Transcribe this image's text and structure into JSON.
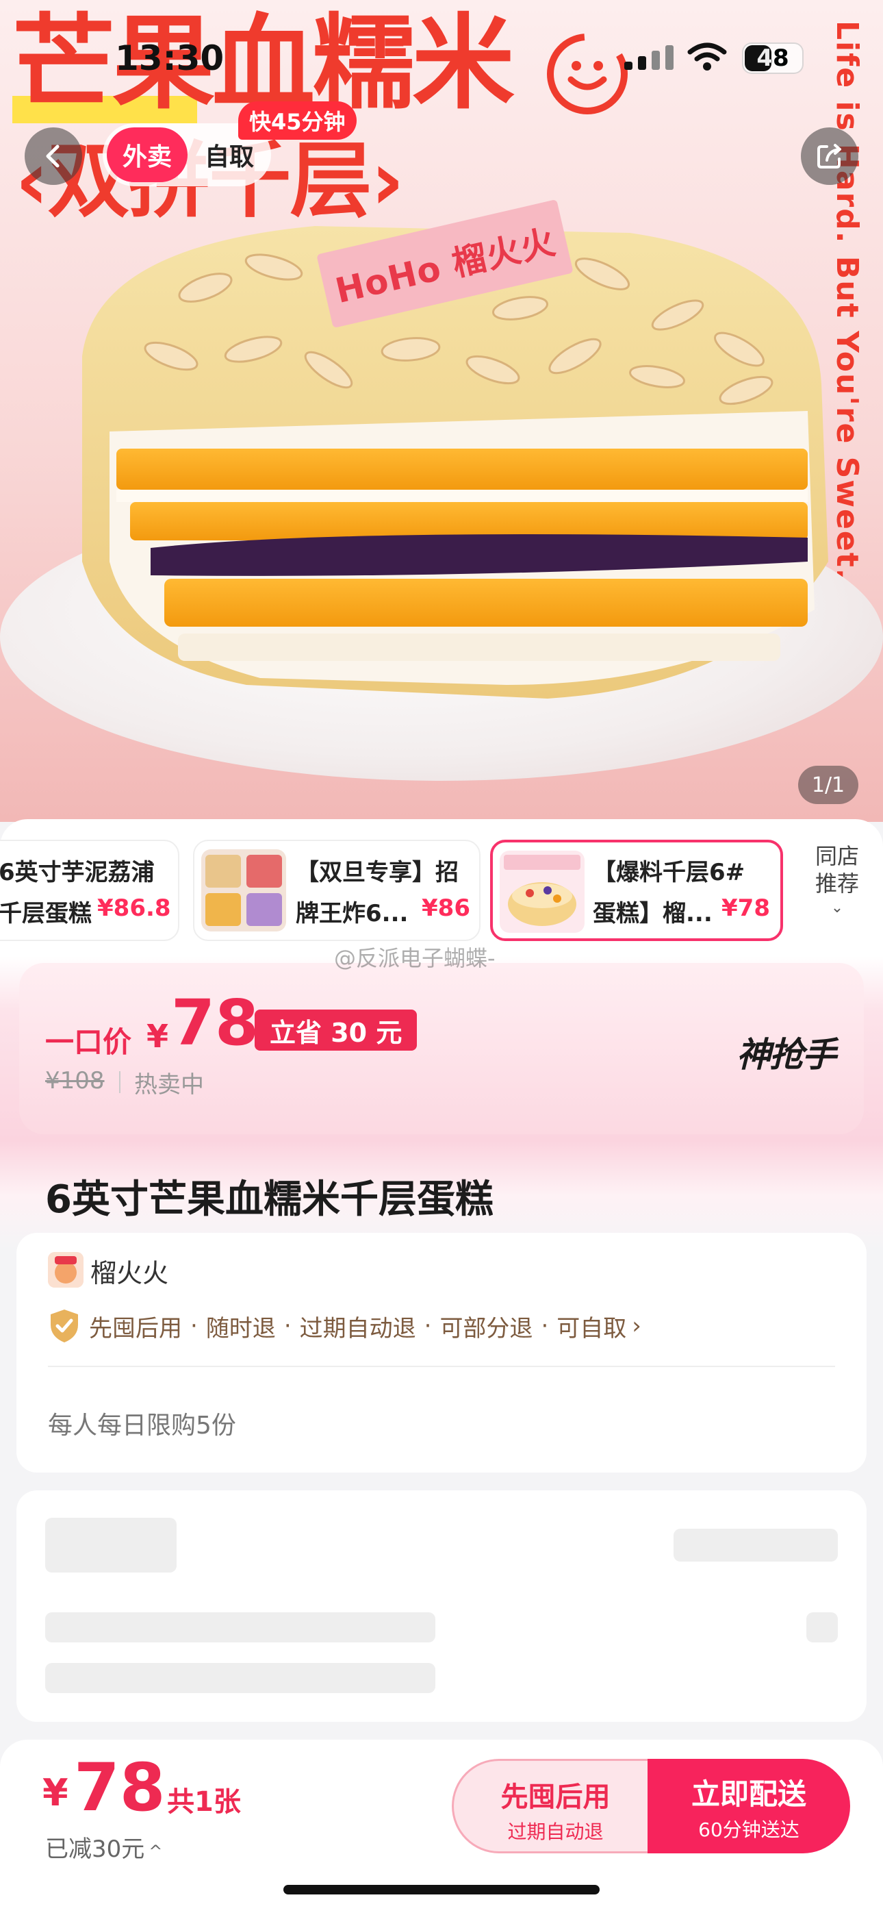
{
  "status_bar": {
    "time": "13:30",
    "battery": "48",
    "battery_level": 0.48
  },
  "hero": {
    "title": "芒果血糯米",
    "subtitle": "‹双拼千层›",
    "side_text": "Life is Hard. But You're Sweet.",
    "cake_tag": "HoHo 榴火火",
    "image_counter": "1/1"
  },
  "nav": {
    "tab_delivery": "外卖",
    "tab_pickup": "自取",
    "fast_badge": "快45分钟"
  },
  "recommend": {
    "items": [
      {
        "line1": "6英寸芋泥荔浦",
        "line2": "千层蛋糕",
        "price": "¥86.8"
      },
      {
        "line1": "【双旦专享】招",
        "line2": "牌王炸6...",
        "price": "¥86"
      },
      {
        "line1": "【爆料千层6#",
        "line2": "蛋糕】榴...",
        "price": "¥78"
      }
    ],
    "store_rec_line1": "同店",
    "store_rec_line2": "推荐"
  },
  "price": {
    "label": "一口价",
    "yen": "¥",
    "value": "78",
    "save_badge": "立省 30 元",
    "original": "¥108",
    "hot": "热卖中",
    "brand": "神抢手"
  },
  "watermark": "@反派电子蝴蝶-",
  "product": {
    "title": "6英寸芒果血糯米千层蛋糕"
  },
  "store": {
    "name": "榴火火",
    "guarantees": [
      "先囤后用",
      "随时退",
      "过期自动退",
      "可部分退",
      "可自取"
    ],
    "limit": "每人每日限购5份"
  },
  "bottom": {
    "yen": "¥",
    "price": "78",
    "count": "共1张",
    "reduced": "已减30元",
    "bnpl_title": "先囤后用",
    "bnpl_sub": "过期自动退",
    "buy_title": "立即配送",
    "buy_sub": "60分钟送达"
  },
  "colors": {
    "accent": "#ee2a52",
    "hero_red": "#ef3b2d",
    "guarantee": "#7d5b3f"
  }
}
